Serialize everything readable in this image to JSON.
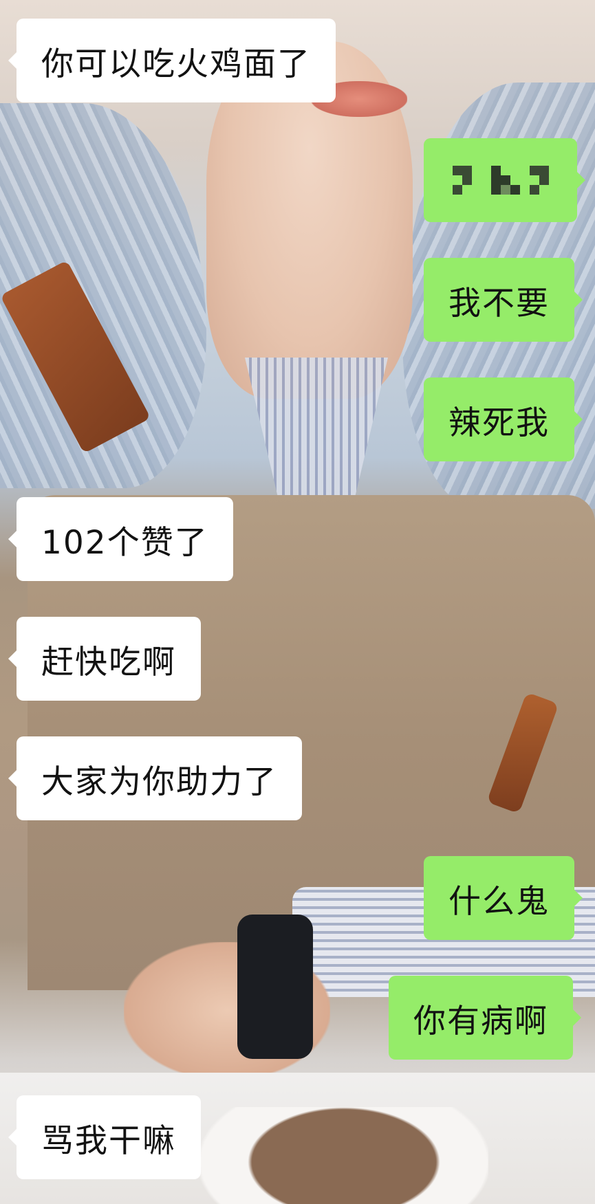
{
  "chat": {
    "messages": [
      {
        "side": "left",
        "text": "你可以吃火鸡面了"
      },
      {
        "side": "right",
        "text": "",
        "note_pixelated": true
      },
      {
        "side": "right",
        "text": "我不要"
      },
      {
        "side": "right",
        "text": "辣死我"
      },
      {
        "side": "left",
        "text": "102个赞了"
      },
      {
        "side": "left",
        "text": "赶快吃啊"
      },
      {
        "side": "left",
        "text": "大家为你助力了"
      },
      {
        "side": "right",
        "text": "什么鬼"
      },
      {
        "side": "right",
        "text": "你有病啊"
      },
      {
        "side": "left",
        "text": "骂我干嘛"
      }
    ]
  },
  "colors": {
    "sent_bubble": "#95ec69",
    "received_bubble": "#ffffff",
    "text": "#121212"
  }
}
